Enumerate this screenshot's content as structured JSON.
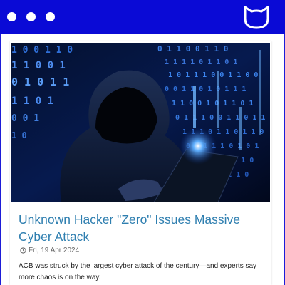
{
  "header": {
    "bar_color": "#0a0ad6",
    "window_controls": [
      "dot",
      "dot",
      "dot"
    ],
    "logo_icon": "cat-head-icon"
  },
  "article": {
    "image_icon": "hacker-laptop-image",
    "title": "Unknown Hacker \"Zero\" Issues Massive Cyber Attack",
    "date": "Fri, 19 Apr 2024",
    "summary": "ACB was struck by the largest cyber attack of the century—and experts say more chaos is on the way.",
    "title_color": "#2f7fb0"
  }
}
